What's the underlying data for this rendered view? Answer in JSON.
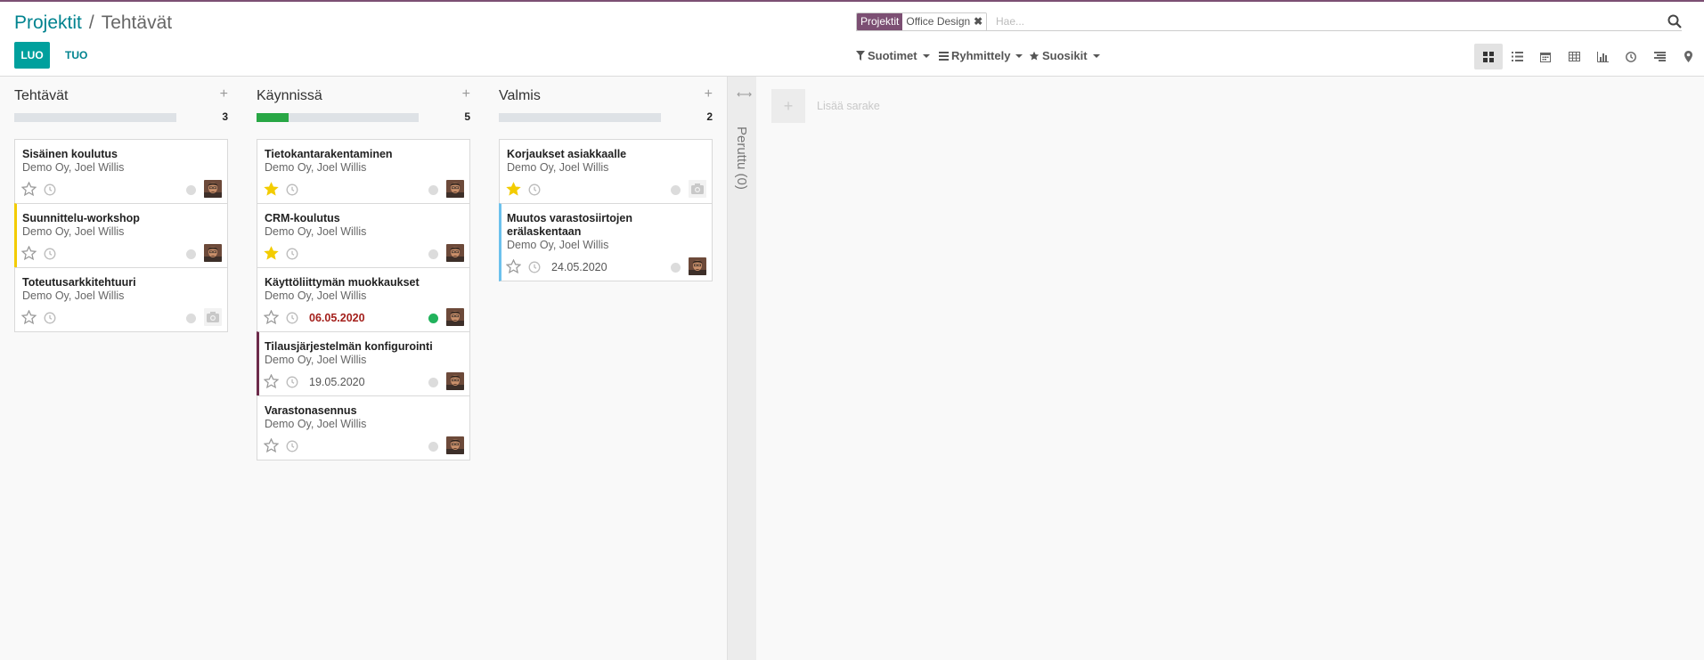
{
  "breadcrumb": {
    "parent": "Projektit",
    "separator": "/",
    "current": "Tehtävät"
  },
  "buttons": {
    "create": "LUO",
    "import": "TUO"
  },
  "search": {
    "facet_label": "Projektit",
    "facet_value": "Office Design",
    "placeholder": "Hae..."
  },
  "filters": {
    "filters_label": "Suotimet",
    "group_label": "Ryhmittely",
    "favorites_label": "Suosikit"
  },
  "views": [
    "kanban-view-icon",
    "list-view-icon",
    "calendar-view-icon",
    "pivot-view-icon",
    "graph-view-icon",
    "activity-view-icon",
    "gantt-view-icon",
    "map-view-icon"
  ],
  "colors": {
    "accent": "#00a09d",
    "link": "#00838f",
    "brand": "#7c4f73",
    "progress": "#28a745",
    "star": "#f3cc00",
    "overdue": "#a4201c"
  },
  "columns": [
    {
      "title": "Tehtävät",
      "count": "3",
      "progress": 0,
      "cards": [
        {
          "title": "Sisäinen koulutus",
          "subtitle": "Demo Oy, Joel Willis",
          "starred": false,
          "deadline": "",
          "state": "grey",
          "avatar": "photo",
          "bar": ""
        },
        {
          "title": "Suunnittelu-workshop",
          "subtitle": "Demo Oy, Joel Willis",
          "starred": false,
          "deadline": "",
          "state": "grey",
          "avatar": "photo",
          "bar": "yellow"
        },
        {
          "title": "Toteutusarkkitehtuuri",
          "subtitle": "Demo Oy, Joel Willis",
          "starred": false,
          "deadline": "",
          "state": "grey",
          "avatar": "placeholder",
          "bar": ""
        }
      ]
    },
    {
      "title": "Käynnissä",
      "count": "5",
      "progress": 0.2,
      "cards": [
        {
          "title": "Tietokantarakentaminen",
          "subtitle": "Demo Oy, Joel Willis",
          "starred": true,
          "deadline": "",
          "state": "grey",
          "avatar": "photo",
          "bar": ""
        },
        {
          "title": "CRM-koulutus",
          "subtitle": "Demo Oy, Joel Willis",
          "starred": true,
          "deadline": "",
          "state": "grey",
          "avatar": "photo",
          "bar": ""
        },
        {
          "title": "Käyttöliittymän muokkaukset",
          "subtitle": "Demo Oy, Joel Willis",
          "starred": false,
          "deadline": "06.05.2020",
          "overdue": true,
          "state": "green",
          "avatar": "photo",
          "bar": ""
        },
        {
          "title": "Tilausjärjestelmän konfigurointi",
          "subtitle": "Demo Oy, Joel Willis",
          "starred": false,
          "deadline": "19.05.2020",
          "state": "grey",
          "avatar": "photo",
          "bar": "purple"
        },
        {
          "title": "Varastonasennus",
          "subtitle": "Demo Oy, Joel Willis",
          "starred": false,
          "deadline": "",
          "state": "grey",
          "avatar": "photo",
          "bar": ""
        }
      ]
    },
    {
      "title": "Valmis",
      "count": "2",
      "progress": 0,
      "cards": [
        {
          "title": "Korjaukset asiakkaalle",
          "subtitle": "Demo Oy, Joel Willis",
          "starred": true,
          "deadline": "",
          "state": "grey",
          "avatar": "placeholder",
          "bar": ""
        },
        {
          "title": "Muutos varastosiirtojen erälaskentaan",
          "subtitle": "Demo Oy, Joel Willis",
          "starred": false,
          "deadline": "24.05.2020",
          "state": "grey",
          "avatar": "photo",
          "bar": "blue",
          "multiline": true
        }
      ]
    }
  ],
  "folded_column": {
    "label": "Peruttu (0)"
  },
  "add_column": {
    "label": "Lisää sarake",
    "plus": "+"
  }
}
